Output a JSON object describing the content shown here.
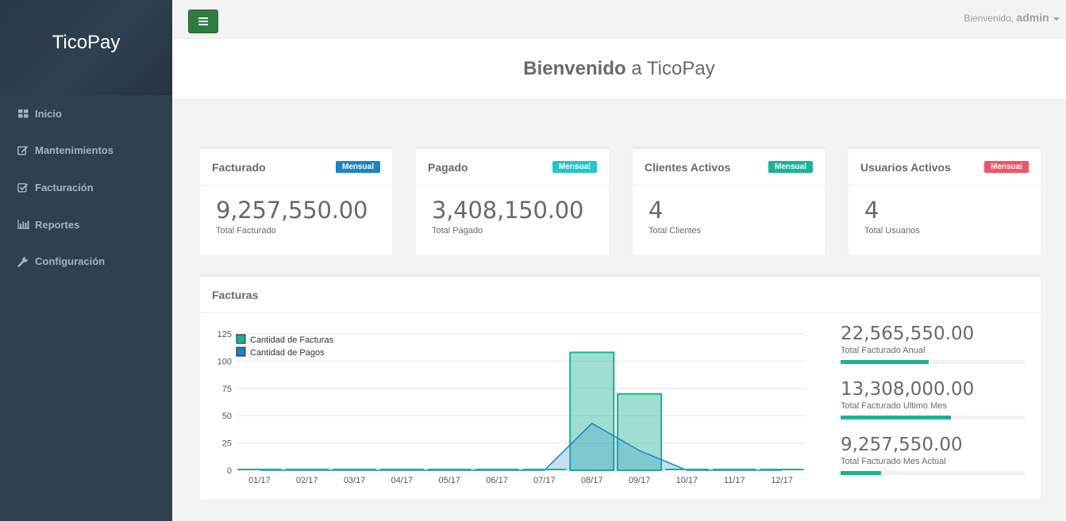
{
  "brand": "TicoPay",
  "sidebar": {
    "items": [
      {
        "label": "Inicio",
        "icon": "th-large-icon"
      },
      {
        "label": "Mantenimientos",
        "icon": "edit-icon"
      },
      {
        "label": "Facturación",
        "icon": "check-square-icon"
      },
      {
        "label": "Reportes",
        "icon": "bar-chart-icon"
      },
      {
        "label": "Configuración",
        "icon": "wrench-icon"
      }
    ]
  },
  "topbar": {
    "welcome_prefix": "Bienvenido,",
    "user": "admin"
  },
  "heading": {
    "bold": "Bienvenido",
    "rest": "a TicoPay"
  },
  "stats": [
    {
      "title": "Facturado",
      "badge": "Mensual",
      "badge_color": "#1c84c6",
      "value": "9,257,550.00",
      "label": "Total Facturado"
    },
    {
      "title": "Pagado",
      "badge": "Mensual",
      "badge_color": "#23c6c8",
      "value": "3,408,150.00",
      "label": "Total Pagado"
    },
    {
      "title": "Clientes Activos",
      "badge": "Mensual",
      "badge_color": "#1ab394",
      "value": "4",
      "label": "Total Clientes"
    },
    {
      "title": "Usuarios Activos",
      "badge": "Mensual",
      "badge_color": "#ed5565",
      "value": "4",
      "label": "Total Usuarios"
    }
  ],
  "facturas": {
    "title": "Facturas",
    "summary": [
      {
        "value": "22,565,550.00",
        "label": "Total Facturado Anual",
        "progress": 0.48
      },
      {
        "value": "13,308,000.00",
        "label": "Total Facturado Ultimo Mes",
        "progress": 0.6
      },
      {
        "value": "9,257,550.00",
        "label": "Total Facturado Mes Actual",
        "progress": 0.22
      }
    ]
  },
  "chart_data": {
    "type": "bar",
    "categories": [
      "01/17",
      "02/17",
      "03/17",
      "04/17",
      "05/17",
      "06/17",
      "07/17",
      "08/17",
      "09/17",
      "10/17",
      "11/17",
      "12/17"
    ],
    "series": [
      {
        "name": "Cantidad de Facturas",
        "kind": "bar",
        "color": "#1ab394",
        "values": [
          0,
          0,
          0,
          0,
          0,
          0,
          0,
          108,
          70,
          0,
          0,
          0
        ]
      },
      {
        "name": "Cantidad de Pagos",
        "kind": "area",
        "color": "#1c84c6",
        "values": [
          0,
          0,
          0,
          0,
          0,
          0,
          0,
          43,
          18,
          0,
          0,
          0
        ]
      }
    ],
    "yticks": [
      0,
      25,
      50,
      75,
      100,
      125
    ],
    "ylim": [
      0,
      125
    ],
    "legend": "top-left",
    "grid": true
  }
}
